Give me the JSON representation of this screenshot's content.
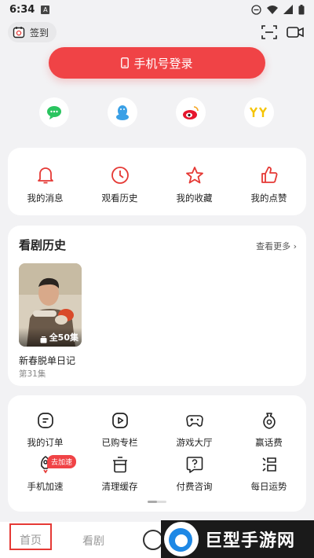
{
  "status_bar": {
    "time": "6:34",
    "notification_letter": "A"
  },
  "header": {
    "checkin_label": "签到",
    "scan_icon": "scan-icon",
    "video_icon": "video-camera-icon"
  },
  "login": {
    "label": "手机号登录",
    "color": "#f04346"
  },
  "social_logins": [
    {
      "name": "wechat-icon",
      "color": "#2ac45f"
    },
    {
      "name": "qq-icon",
      "color": "#3aa0e6"
    },
    {
      "name": "weibo-icon",
      "color": "#e6162d"
    },
    {
      "name": "yy-icon",
      "color": "#f5c400"
    }
  ],
  "quick_actions": [
    {
      "label": "我的消息",
      "icon": "bell-icon"
    },
    {
      "label": "观看历史",
      "icon": "clock-icon"
    },
    {
      "label": "我的收藏",
      "icon": "star-icon"
    },
    {
      "label": "我的点赞",
      "icon": "thumbs-up-icon"
    }
  ],
  "history": {
    "title": "看剧历史",
    "more": "查看更多",
    "items": [
      {
        "name": "新春脱单日记",
        "episode": "第31集",
        "count": "全50集"
      }
    ]
  },
  "tools": {
    "items": [
      {
        "label": "我的订单",
        "icon": "order-icon"
      },
      {
        "label": "已购专栏",
        "icon": "play-icon"
      },
      {
        "label": "游戏大厅",
        "icon": "gamepad-icon"
      },
      {
        "label": "赢话费",
        "icon": "money-bag-icon"
      },
      {
        "label": "手机加速",
        "icon": "rocket-icon"
      },
      {
        "label": "清理缓存",
        "icon": "trash-icon"
      },
      {
        "label": "付费咨询",
        "icon": "question-icon"
      },
      {
        "label": "每日运势",
        "icon": "fortune-icon"
      }
    ],
    "accel_badge": "去加速"
  },
  "tabbar": {
    "home": "首页",
    "drama": "看剧"
  },
  "watermark": {
    "text": "巨型手游网"
  }
}
